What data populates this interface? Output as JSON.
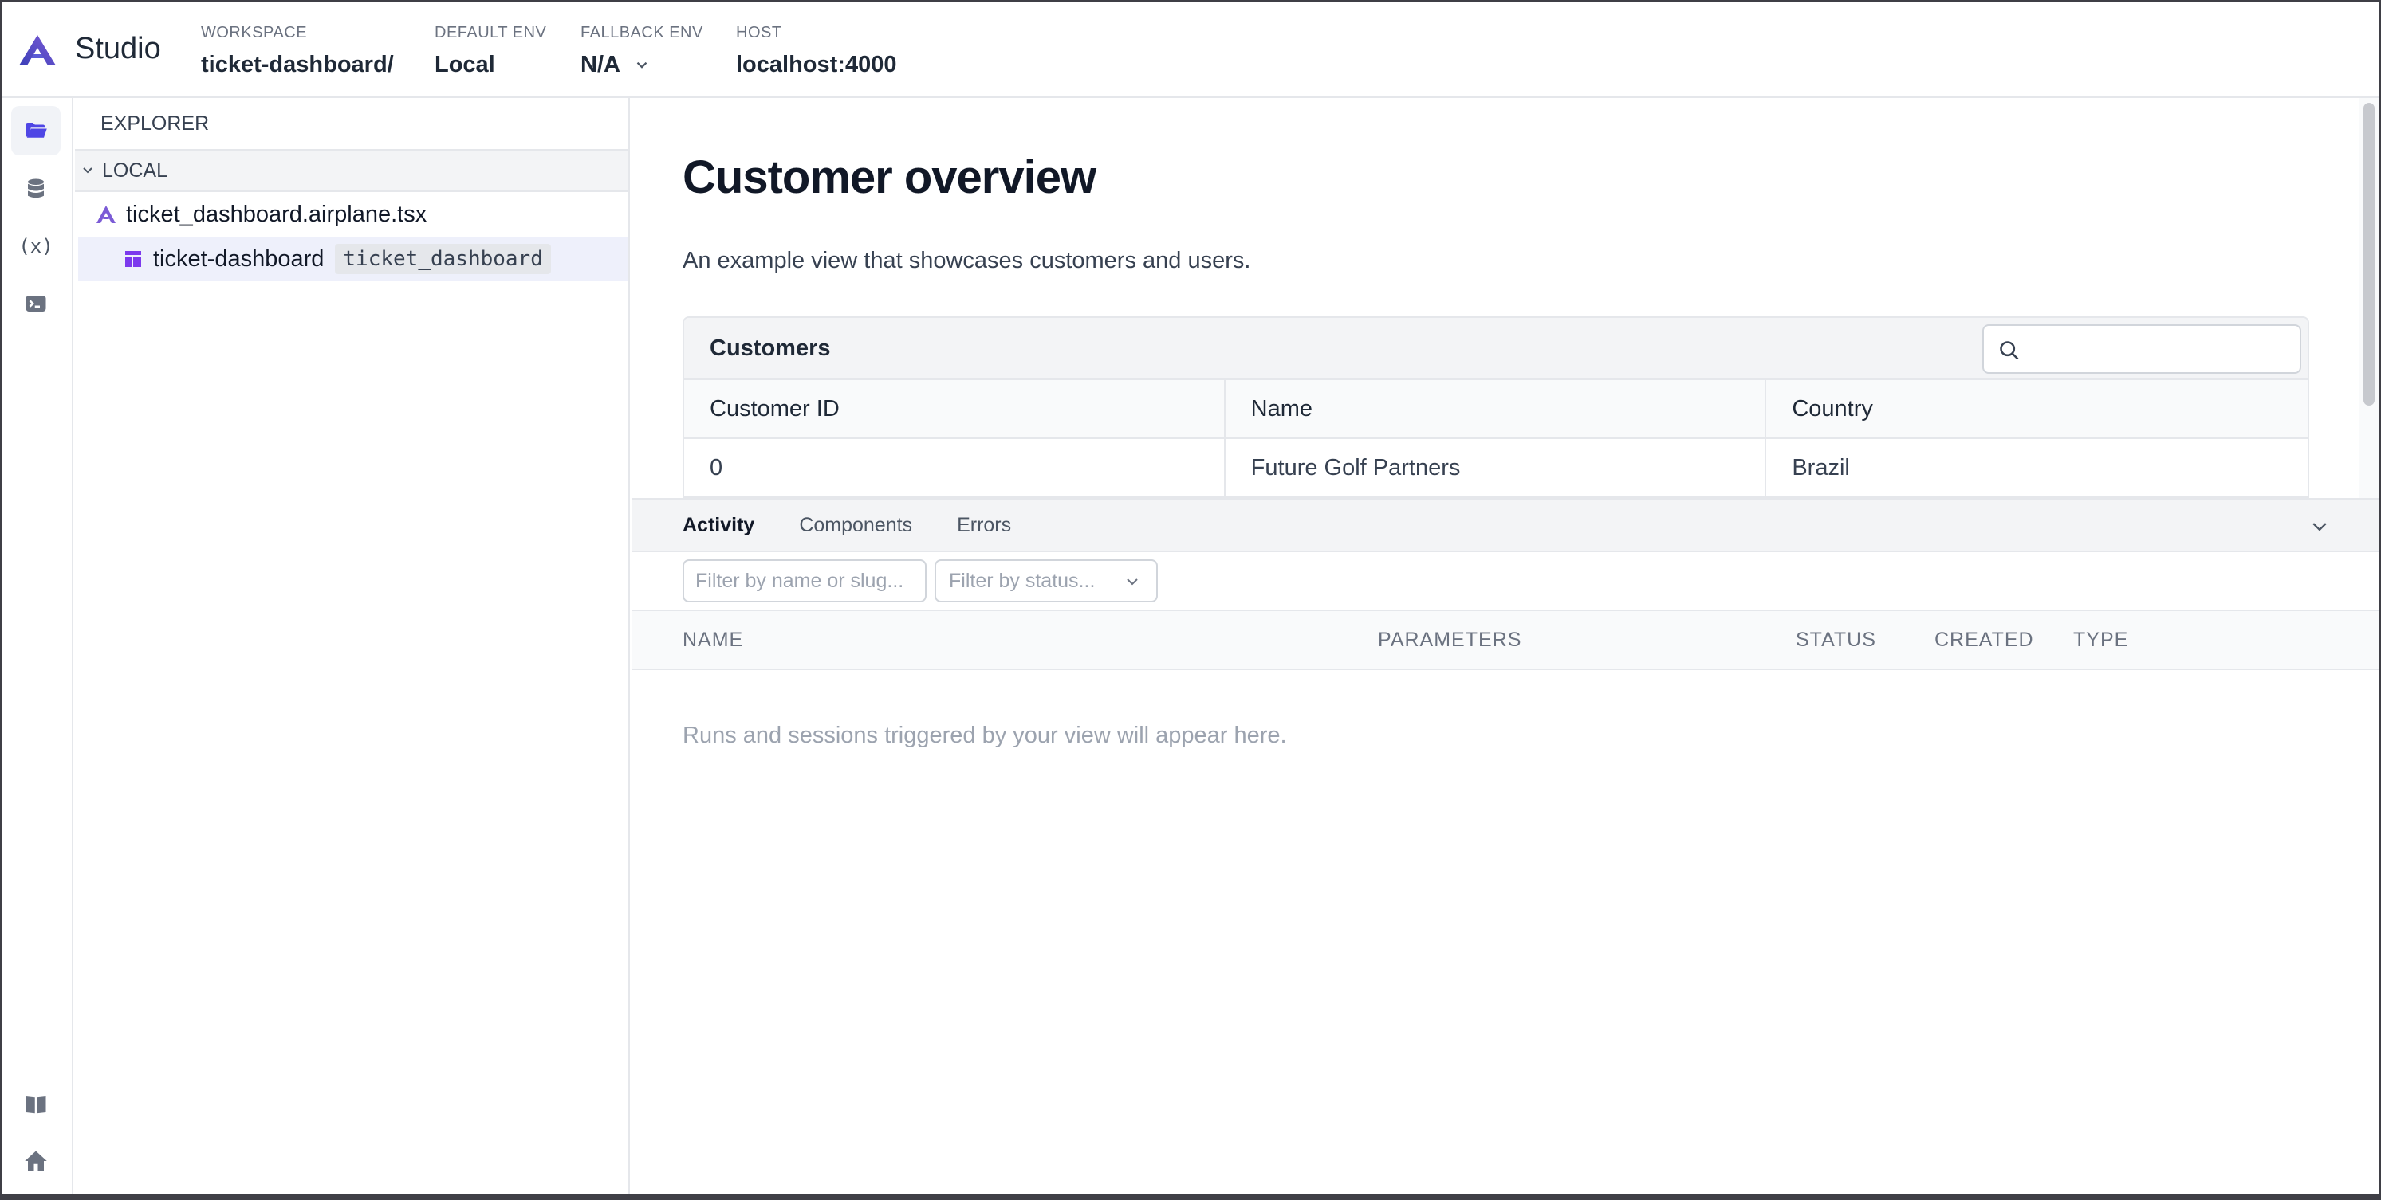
{
  "app": {
    "brand": "Studio",
    "accent": "#5b5bd6"
  },
  "header": {
    "workspace": {
      "label": "WORKSPACE",
      "value": "ticket-dashboard/"
    },
    "default_env": {
      "label": "DEFAULT ENV",
      "value": "Local"
    },
    "fallback_env": {
      "label": "FALLBACK ENV",
      "value": "N/A"
    },
    "host": {
      "label": "HOST",
      "value": "localhost:4000"
    }
  },
  "rail": {
    "items": [
      {
        "icon": "folder-icon",
        "active": true
      },
      {
        "icon": "database-icon",
        "active": false
      },
      {
        "icon": "variable-icon",
        "text": "(x)",
        "active": false
      },
      {
        "icon": "terminal-icon",
        "active": false
      }
    ],
    "bottom_items": [
      {
        "icon": "book-icon"
      },
      {
        "icon": "home-icon"
      }
    ]
  },
  "explorer": {
    "title": "EXPLORER",
    "section": "LOCAL",
    "file": "ticket_dashboard.airplane.tsx",
    "view": {
      "name": "ticket-dashboard",
      "slug": "ticket_dashboard"
    }
  },
  "preview": {
    "title": "Customer overview",
    "description": "An example view that showcases customers and users.",
    "table": {
      "title": "Customers",
      "search_placeholder": "",
      "columns": [
        "Customer ID",
        "Name",
        "Country"
      ],
      "rows": [
        [
          "0",
          "Future Golf Partners",
          "Brazil"
        ]
      ]
    }
  },
  "panel": {
    "tabs": [
      "Activity",
      "Components",
      "Errors"
    ],
    "active_tab": "Activity",
    "filter_name_placeholder": "Filter by name or slug...",
    "filter_status_placeholder": "Filter by status...",
    "columns": [
      "NAME",
      "PARAMETERS",
      "STATUS",
      "CREATED",
      "TYPE"
    ],
    "empty_message": "Runs and sessions triggered by your view will appear here."
  }
}
